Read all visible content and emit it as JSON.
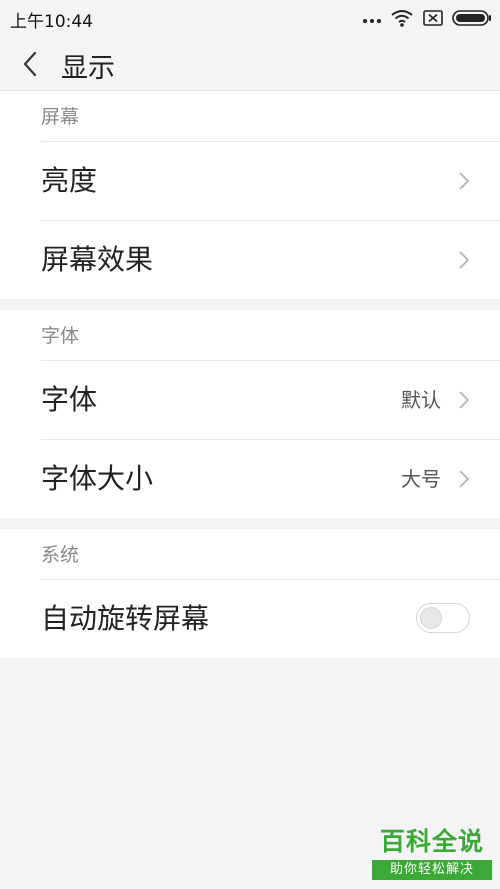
{
  "status_bar": {
    "time": "上午10:44",
    "icons": [
      "more-dots-icon",
      "wifi-icon",
      "sim-none-icon",
      "battery-icon"
    ]
  },
  "header": {
    "title": "显示",
    "back_icon": "chevron-left-icon"
  },
  "sections": [
    {
      "title": "屏幕",
      "rows": [
        {
          "label": "亮度",
          "value": "",
          "control": "chevron"
        },
        {
          "label": "屏幕效果",
          "value": "",
          "control": "chevron"
        }
      ]
    },
    {
      "title": "字体",
      "rows": [
        {
          "label": "字体",
          "value": "默认",
          "control": "chevron"
        },
        {
          "label": "字体大小",
          "value": "大号",
          "control": "chevron"
        }
      ]
    },
    {
      "title": "系统",
      "rows": [
        {
          "label": "自动旋转屏幕",
          "value": "",
          "control": "toggle",
          "enabled": false
        }
      ]
    }
  ],
  "watermark": {
    "title": "百科全说",
    "subtitle": "助你轻松解决"
  },
  "colors": {
    "background": "#f4f3f5",
    "card": "#ffffff",
    "watermark_green": "#3aa935"
  }
}
